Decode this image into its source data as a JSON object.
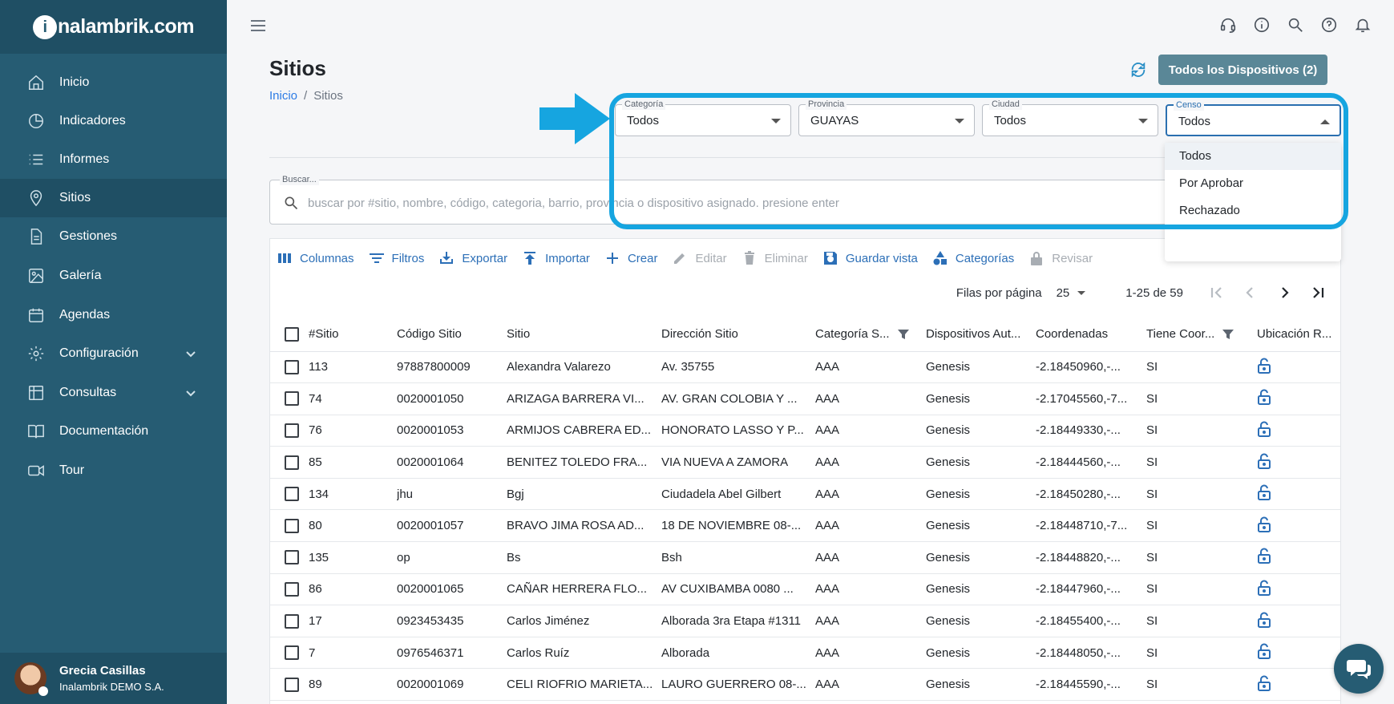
{
  "brand": {
    "name": "nalambrik.com",
    "mark": "i"
  },
  "sidebar": {
    "items": [
      {
        "label": "Inicio"
      },
      {
        "label": "Indicadores"
      },
      {
        "label": "Informes"
      },
      {
        "label": "Sitios",
        "active": true
      },
      {
        "label": "Gestiones"
      },
      {
        "label": "Galería"
      },
      {
        "label": "Agendas"
      },
      {
        "label": "Configuración",
        "expandable": true
      },
      {
        "label": "Consultas",
        "expandable": true
      },
      {
        "label": "Documentación"
      },
      {
        "label": "Tour"
      }
    ],
    "user": {
      "name": "Grecia Casillas",
      "org": "Inalambrik DEMO S.A."
    }
  },
  "header": {
    "title": "Sitios",
    "breadcrumb": {
      "home": "Inicio",
      "current": "Sitios",
      "separator": "/"
    },
    "all_devices_button": "Todos los Dispositivos (2)"
  },
  "filters": {
    "categoria": {
      "label": "Categoría",
      "value": "Todos"
    },
    "provincia": {
      "label": "Provincia",
      "value": "GUAYAS"
    },
    "ciudad": {
      "label": "Ciudad",
      "value": "Todos"
    },
    "censo": {
      "label": "Censo",
      "value": "Todos",
      "options": [
        "Todos",
        "Por Aprobar",
        "Rechazado"
      ]
    }
  },
  "search": {
    "label": "Buscar...",
    "placeholder": "buscar por #sitio, nombre, código, categoria, barrio, provincia o dispositivo asignado. presione enter"
  },
  "toolbar": {
    "columnas": "Columnas",
    "filtros": "Filtros",
    "exportar": "Exportar",
    "importar": "Importar",
    "crear": "Crear",
    "editar": "Editar",
    "eliminar": "Eliminar",
    "guardar_vista": "Guardar vista",
    "categorias": "Categorías",
    "revisar": "Revisar"
  },
  "pager": {
    "rows_label": "Filas por página",
    "rows_value": "25",
    "range": "1-25 de 59"
  },
  "table": {
    "columns": [
      "#Sitio",
      "Código Sitio",
      "Sitio",
      "Dirección Sitio",
      "Categoría S...",
      "Dispositivos Aut...",
      "Coordenadas",
      "Tiene Coor...",
      "Ubicación R..."
    ],
    "rows": [
      [
        "113",
        "97887800009",
        "Alexandra Valarezo",
        "Av. 35755",
        "AAA",
        "Genesis",
        "-2.18450960,-...",
        "SI"
      ],
      [
        "74",
        "0020001050",
        "ARIZAGA BARRERA VI...",
        "AV. GRAN COLOBIA Y ...",
        "AAA",
        "Genesis",
        "-2.17045560,-7...",
        "SI"
      ],
      [
        "76",
        "0020001053",
        "ARMIJOS CABRERA ED...",
        "HONORATO LASSO Y P...",
        "AAA",
        "Genesis",
        "-2.18449330,-...",
        "SI"
      ],
      [
        "85",
        "0020001064",
        "BENITEZ TOLEDO FRA...",
        "VIA NUEVA A ZAMORA",
        "AAA",
        "Genesis",
        "-2.18444560,-...",
        "SI"
      ],
      [
        "134",
        "jhu",
        "Bgj",
        "Ciudadela Abel Gilbert",
        "AAA",
        "Genesis",
        "-2.18450280,-...",
        "SI"
      ],
      [
        "80",
        "0020001057",
        "BRAVO JIMA ROSA AD...",
        "18 DE NOVIEMBRE 08-...",
        "AAA",
        "Genesis",
        "-2.18448710,-7...",
        "SI"
      ],
      [
        "135",
        "op",
        "Bs",
        "Bsh",
        "AAA",
        "Genesis",
        "-2.18448820,-...",
        "SI"
      ],
      [
        "86",
        "0020001065",
        "CAÑAR HERRERA FLO...",
        "AV CUXIBAMBA 0080 ...",
        "AAA",
        "Genesis",
        "-2.18447960,-...",
        "SI"
      ],
      [
        "17",
        "0923453435",
        "Carlos Jiménez",
        "Alborada 3ra Etapa #1311",
        "AAA",
        "Genesis",
        "-2.18455400,-...",
        "SI"
      ],
      [
        "7",
        "0976546371",
        "Carlos Ruíz",
        "Alborada",
        "AAA",
        "Genesis",
        "-2.18448050,-...",
        "SI"
      ],
      [
        "89",
        "0020001069",
        "CELI RIOFRIO MARIETA...",
        "LAURO GUERRERO 08-...",
        "AAA",
        "Genesis",
        "-2.18445590,-...",
        "SI"
      ]
    ]
  },
  "colors": {
    "sidebar": "#265c73",
    "accent": "#2c6fb7",
    "highlight": "#16a5e0"
  }
}
